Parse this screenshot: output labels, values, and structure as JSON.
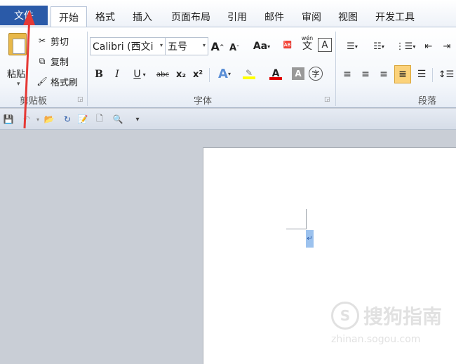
{
  "tabs": {
    "file": "文件",
    "items": [
      "开始",
      "格式",
      "插入",
      "页面布局",
      "引用",
      "邮件",
      "审阅",
      "视图",
      "开发工具"
    ]
  },
  "clipboard": {
    "paste": "粘贴",
    "cut": "剪切",
    "copy": "复制",
    "format_painter": "格式刷",
    "group_label": "剪贴板"
  },
  "font": {
    "font_name": "Calibri (西文i",
    "font_size": "五号",
    "group_label": "字体",
    "bold": "B",
    "italic": "I",
    "underline": "U",
    "strike": "abc",
    "subscript": "x₂",
    "superscript": "x²",
    "grow": "A",
    "shrink": "A",
    "change_case": "Aa",
    "pinyin": "wén",
    "pinyin_char": "文",
    "border_char": "A",
    "text_effect": "A",
    "highlight": "ab",
    "font_color": "A",
    "char_shade": "A",
    "enclose": "字"
  },
  "paragraph": {
    "group_label": "段落"
  },
  "watermark": {
    "logo": "S",
    "text": "搜狗指南",
    "url": "zhinan.sogou.com"
  },
  "document": {
    "paragraph_mark": "↵"
  },
  "colors": {
    "file_tab": "#2a5aa8",
    "annotation_arrow": "#e53935",
    "highlight_bar": "#ffff00",
    "font_color_bar": "#e00000"
  }
}
